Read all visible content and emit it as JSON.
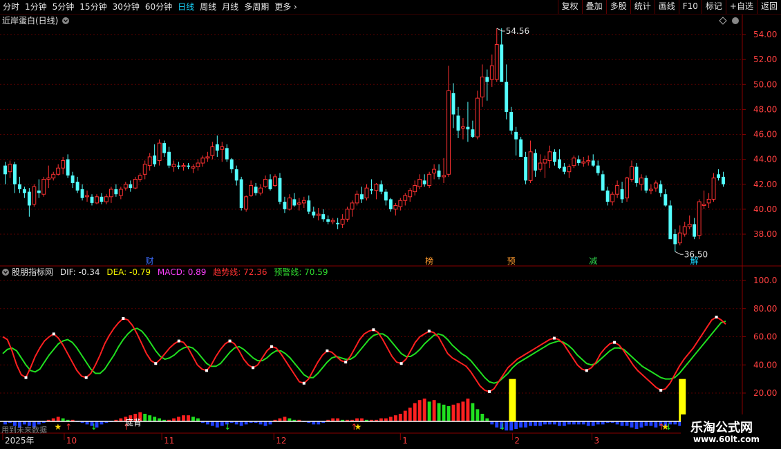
{
  "toolbar": {
    "periods": [
      "分时",
      "1分钟",
      "5分钟",
      "15分钟",
      "30分钟",
      "60分钟",
      "日线",
      "周线",
      "月线",
      "多周期",
      "更多"
    ],
    "active_period": "日线",
    "right_buttons": [
      "复权",
      "叠加",
      "多股",
      "统计",
      "画线",
      "F10",
      "标记",
      "+自选",
      "返回"
    ]
  },
  "main_panel": {
    "title": "近岸蛋白(日线)",
    "y_ticks": [
      "54.00",
      "52.00",
      "50.00",
      "48.00",
      "46.00",
      "44.00",
      "42.00",
      "40.00",
      "38.00"
    ],
    "high_marker": "54.56",
    "low_marker": "36.50",
    "event_tags": [
      {
        "text": "财",
        "color": "#3c6cff"
      },
      {
        "text": "榜",
        "color": "#ff9a2e"
      },
      {
        "text": "预",
        "color": "#ff9a2e"
      },
      {
        "text": "减",
        "color": "#2fd14b"
      },
      {
        "text": "解",
        "color": "#19d7ff"
      }
    ]
  },
  "indicator_panel": {
    "name": "股朋指标网",
    "dif": "DIF: -0.34",
    "dea": "DEA: -0.79",
    "macd": "MACD: 0.89",
    "trend": "趋势线: 72.36",
    "warn": "预警线: 70.59",
    "y_ticks": [
      "100.0",
      "80.00",
      "60.00",
      "40.00",
      "20.00"
    ],
    "annotation": "底背",
    "watermark": "用到未来数据"
  },
  "time_axis": {
    "labels": [
      "2025年",
      "10",
      "11",
      "12",
      "1",
      "2",
      "3"
    ]
  },
  "logo": {
    "line1": "乐淘公式网",
    "line2": "www.60lt.com"
  },
  "chart_data": {
    "type": "candlestick",
    "title": "近岸蛋白(日线)",
    "price_range": [
      36.0,
      55.5
    ],
    "up_color": "#ff3232",
    "down_color": "#54ffff",
    "candles": [
      [
        43.5,
        43.8,
        42.0,
        42.8
      ],
      [
        43.0,
        43.9,
        42.5,
        43.6
      ],
      [
        43.6,
        43.8,
        41.3,
        42.0
      ],
      [
        42.0,
        42.6,
        41.3,
        41.6
      ],
      [
        41.6,
        41.8,
        40.9,
        41.3
      ],
      [
        41.4,
        41.7,
        39.4,
        40.3
      ],
      [
        40.4,
        42.0,
        40.2,
        41.8
      ],
      [
        41.5,
        42.4,
        40.9,
        41.3
      ],
      [
        41.2,
        42.6,
        41.0,
        42.4
      ],
      [
        42.4,
        43.5,
        41.7,
        42.5
      ],
      [
        42.5,
        43.0,
        42.3,
        42.8
      ],
      [
        42.8,
        43.6,
        42.7,
        43.3
      ],
      [
        43.3,
        44.2,
        42.8,
        43.9
      ],
      [
        44.0,
        44.4,
        42.5,
        42.7
      ],
      [
        42.7,
        43.0,
        41.7,
        42.1
      ],
      [
        42.2,
        42.6,
        41.3,
        41.5
      ],
      [
        41.6,
        42.0,
        40.7,
        40.9
      ],
      [
        41.0,
        41.5,
        40.6,
        41.1
      ],
      [
        41.0,
        41.2,
        40.3,
        40.5
      ],
      [
        40.5,
        41.2,
        40.4,
        41.0
      ],
      [
        41.0,
        41.3,
        40.4,
        40.6
      ],
      [
        40.6,
        41.2,
        40.4,
        41.0
      ],
      [
        41.0,
        41.8,
        40.5,
        41.6
      ],
      [
        41.6,
        42.0,
        41.0,
        41.2
      ],
      [
        41.1,
        41.8,
        40.8,
        41.6
      ],
      [
        41.7,
        42.2,
        41.5,
        42.0
      ],
      [
        42.0,
        42.3,
        41.4,
        41.7
      ],
      [
        41.7,
        42.6,
        41.6,
        42.4
      ],
      [
        42.4,
        42.9,
        42.2,
        42.7
      ],
      [
        42.8,
        43.9,
        42.4,
        43.6
      ],
      [
        43.5,
        44.5,
        43.1,
        44.2
      ],
      [
        44.3,
        45.2,
        43.4,
        43.6
      ],
      [
        43.9,
        45.6,
        43.5,
        45.3
      ],
      [
        45.3,
        45.5,
        44.2,
        44.5
      ],
      [
        44.6,
        45.0,
        43.3,
        43.5
      ],
      [
        43.4,
        43.9,
        43.0,
        43.6
      ],
      [
        43.5,
        43.8,
        43.2,
        43.4
      ],
      [
        43.4,
        43.7,
        43.1,
        43.5
      ],
      [
        43.5,
        43.7,
        43.2,
        43.4
      ],
      [
        43.3,
        43.6,
        42.9,
        43.4
      ],
      [
        43.4,
        44.0,
        43.1,
        43.7
      ],
      [
        43.7,
        44.3,
        43.4,
        44.1
      ],
      [
        44.1,
        44.6,
        43.8,
        44.2
      ],
      [
        44.3,
        45.4,
        44.0,
        45.0
      ],
      [
        45.2,
        45.9,
        44.2,
        44.7
      ],
      [
        44.8,
        45.4,
        43.8,
        45.0
      ],
      [
        44.9,
        45.2,
        43.8,
        44.0
      ],
      [
        44.0,
        44.1,
        42.9,
        43.2
      ],
      [
        43.2,
        43.5,
        41.9,
        42.3
      ],
      [
        42.4,
        42.6,
        39.9,
        40.1
      ],
      [
        40.0,
        41.1,
        39.8,
        41.0
      ],
      [
        41.1,
        42.3,
        41.0,
        41.9
      ],
      [
        41.8,
        42.1,
        41.1,
        41.3
      ],
      [
        41.3,
        42.0,
        41.1,
        41.7
      ],
      [
        41.8,
        42.7,
        41.7,
        42.4
      ],
      [
        42.4,
        42.8,
        41.5,
        41.6
      ],
      [
        41.9,
        42.8,
        41.8,
        42.6
      ],
      [
        42.5,
        42.9,
        40.4,
        40.6
      ],
      [
        40.6,
        41.0,
        39.7,
        40.0
      ],
      [
        40.0,
        41.2,
        39.9,
        40.9
      ],
      [
        40.8,
        41.3,
        40.2,
        40.3
      ],
      [
        40.4,
        40.9,
        39.9,
        40.5
      ],
      [
        40.5,
        41.0,
        40.1,
        40.7
      ],
      [
        40.7,
        41.1,
        39.6,
        39.8
      ],
      [
        39.8,
        40.2,
        39.3,
        39.5
      ],
      [
        39.5,
        40.1,
        39.1,
        39.6
      ],
      [
        39.6,
        40.0,
        39.0,
        39.2
      ],
      [
        39.2,
        39.5,
        38.8,
        39.0
      ],
      [
        39.0,
        39.3,
        38.8,
        39.1
      ],
      [
        38.9,
        39.3,
        38.4,
        38.8
      ],
      [
        38.8,
        39.6,
        38.5,
        39.2
      ],
      [
        39.2,
        40.2,
        39.0,
        40.0
      ],
      [
        40.0,
        40.7,
        39.4,
        40.5
      ],
      [
        40.5,
        41.5,
        40.3,
        41.2
      ],
      [
        41.2,
        41.8,
        40.5,
        40.8
      ],
      [
        40.9,
        42.0,
        40.7,
        41.7
      ],
      [
        41.6,
        42.4,
        41.2,
        41.5
      ],
      [
        41.5,
        42.1,
        40.8,
        42.0
      ],
      [
        42.0,
        42.3,
        41.2,
        41.4
      ],
      [
        41.4,
        41.6,
        40.3,
        40.7
      ],
      [
        40.8,
        40.9,
        39.8,
        40.0
      ],
      [
        40.0,
        40.5,
        39.5,
        40.3
      ],
      [
        40.2,
        40.9,
        39.9,
        40.7
      ],
      [
        40.7,
        41.3,
        40.3,
        41.1
      ],
      [
        41.0,
        41.7,
        40.6,
        41.5
      ],
      [
        41.4,
        42.3,
        41.1,
        41.9
      ],
      [
        41.8,
        42.8,
        41.6,
        42.4
      ],
      [
        42.3,
        42.8,
        41.8,
        42.0
      ],
      [
        41.9,
        43.0,
        41.7,
        42.8
      ],
      [
        42.9,
        43.6,
        42.4,
        43.2
      ],
      [
        43.1,
        43.6,
        42.4,
        42.6
      ],
      [
        42.6,
        44.1,
        42.1,
        42.7
      ],
      [
        42.8,
        51.5,
        42.6,
        49.5
      ],
      [
        49.3,
        50.1,
        46.5,
        47.6
      ],
      [
        47.5,
        48.2,
        45.7,
        46.3
      ],
      [
        46.5,
        47.3,
        45.6,
        46.6
      ],
      [
        46.6,
        48.6,
        45.4,
        46.4
      ],
      [
        46.4,
        47.1,
        45.7,
        45.8
      ],
      [
        45.8,
        49.5,
        45.6,
        48.9
      ],
      [
        49.0,
        51.6,
        48.2,
        50.6
      ],
      [
        50.6,
        51.2,
        48.7,
        50.2
      ],
      [
        50.4,
        52.4,
        49.8,
        51.5
      ],
      [
        50.4,
        54.5,
        50.2,
        53.2
      ],
      [
        53.2,
        54.5,
        50.8,
        50.2
      ],
      [
        50.2,
        51.6,
        47.2,
        47.8
      ],
      [
        47.8,
        48.2,
        46.0,
        46.3
      ],
      [
        46.2,
        46.6,
        44.3,
        45.6
      ],
      [
        45.6,
        45.8,
        44.3,
        44.2
      ],
      [
        44.2,
        44.6,
        42.0,
        42.3
      ],
      [
        42.3,
        45.5,
        42.1,
        44.6
      ],
      [
        44.5,
        44.8,
        42.6,
        43.1
      ],
      [
        43.2,
        44.4,
        43.0,
        43.7
      ],
      [
        43.7,
        44.3,
        42.5,
        44.0
      ],
      [
        43.9,
        45.1,
        43.3,
        44.6
      ],
      [
        44.6,
        44.8,
        43.5,
        43.8
      ],
      [
        44.0,
        44.8,
        43.2,
        43.3
      ],
      [
        43.4,
        43.7,
        42.8,
        43.0
      ],
      [
        43.0,
        43.6,
        42.5,
        43.4
      ],
      [
        43.5,
        44.3,
        43.3,
        44.1
      ],
      [
        44.0,
        44.3,
        43.5,
        43.7
      ],
      [
        43.7,
        44.2,
        43.4,
        43.8
      ],
      [
        43.8,
        44.3,
        43.5,
        43.9
      ],
      [
        43.9,
        44.4,
        43.4,
        43.5
      ],
      [
        43.5,
        43.9,
        42.7,
        42.9
      ],
      [
        42.8,
        43.1,
        41.5,
        41.5
      ],
      [
        41.5,
        41.8,
        40.3,
        40.6
      ],
      [
        40.6,
        41.4,
        40.3,
        41.2
      ],
      [
        41.2,
        42.3,
        40.9,
        41.9
      ],
      [
        41.6,
        42.2,
        40.5,
        40.8
      ],
      [
        40.9,
        42.6,
        40.6,
        42.5
      ],
      [
        42.4,
        43.9,
        42.2,
        43.4
      ],
      [
        43.4,
        43.7,
        41.8,
        42.1
      ],
      [
        42.0,
        42.8,
        41.5,
        42.5
      ],
      [
        42.5,
        42.7,
        41.3,
        41.5
      ],
      [
        41.5,
        42.0,
        41.2,
        41.6
      ],
      [
        41.7,
        42.3,
        41.4,
        42.1
      ],
      [
        42.0,
        42.3,
        41.0,
        41.3
      ],
      [
        41.2,
        41.6,
        40.2,
        40.3
      ],
      [
        40.3,
        40.7,
        38.0,
        37.6
      ],
      [
        38.0,
        38.4,
        36.6,
        37.2
      ],
      [
        37.3,
        38.7,
        37.1,
        38.1
      ],
      [
        38.0,
        39.0,
        37.8,
        38.6
      ],
      [
        38.6,
        39.5,
        38.4,
        38.8
      ],
      [
        38.8,
        39.3,
        37.6,
        37.8
      ],
      [
        37.9,
        40.8,
        37.6,
        40.6
      ],
      [
        40.3,
        41.5,
        40.0,
        40.4
      ],
      [
        40.5,
        41.3,
        40.1,
        40.8
      ],
      [
        40.8,
        42.9,
        40.6,
        42.5
      ],
      [
        42.8,
        43.2,
        42.3,
        42.5
      ],
      [
        42.6,
        43.0,
        41.8,
        42.0
      ]
    ],
    "indicator": {
      "y_range": [
        0,
        110
      ],
      "line_red": [
        60,
        58,
        50,
        40,
        33,
        31,
        38,
        46,
        52,
        57,
        60,
        62,
        59,
        54,
        48,
        42,
        36,
        32,
        31,
        34,
        40,
        47,
        55,
        61,
        66,
        70,
        73,
        72,
        68,
        62,
        55,
        48,
        43,
        41,
        44,
        48,
        52,
        55,
        57,
        56,
        52,
        46,
        40,
        37,
        36,
        40,
        46,
        51,
        55,
        57,
        55,
        50,
        44,
        40,
        38,
        40,
        45,
        50,
        53,
        52,
        48,
        43,
        38,
        33,
        28,
        27,
        30,
        36,
        42,
        47,
        50,
        49,
        46,
        43,
        42,
        46,
        52,
        58,
        62,
        64,
        65,
        63,
        58,
        52,
        46,
        42,
        41,
        44,
        50,
        56,
        60,
        62,
        64,
        63,
        60,
        54,
        48,
        45,
        43,
        41,
        39,
        35,
        30,
        25,
        22,
        21,
        23,
        28,
        33,
        38,
        41,
        44,
        46,
        48,
        50,
        52,
        54,
        56,
        58,
        59,
        58,
        55,
        50,
        45,
        40,
        37,
        36,
        38,
        42,
        48,
        52,
        55,
        56,
        54,
        50,
        45,
        40,
        36,
        33,
        30,
        27,
        24,
        22,
        23,
        27,
        33,
        39,
        44,
        48,
        52,
        57,
        62,
        67,
        72,
        74,
        72,
        69
      ],
      "line_green": [
        48,
        51,
        52,
        50,
        45,
        40,
        36,
        35,
        37,
        42,
        47,
        51,
        55,
        57,
        58,
        56,
        52,
        47,
        42,
        37,
        34,
        34,
        37,
        42,
        47,
        53,
        58,
        62,
        65,
        66,
        64,
        60,
        55,
        50,
        46,
        44,
        45,
        47,
        50,
        52,
        53,
        52,
        49,
        45,
        41,
        39,
        39,
        41,
        45,
        49,
        52,
        53,
        51,
        48,
        45,
        43,
        43,
        45,
        48,
        50,
        50,
        48,
        45,
        41,
        37,
        33,
        31,
        31,
        34,
        38,
        42,
        45,
        46,
        45,
        44,
        44,
        46,
        50,
        54,
        58,
        61,
        62,
        62,
        60,
        56,
        52,
        48,
        46,
        46,
        48,
        51,
        55,
        58,
        61,
        62,
        61,
        58,
        54,
        51,
        48,
        46,
        43,
        39,
        35,
        31,
        28,
        27,
        28,
        31,
        34,
        38,
        41,
        43,
        45,
        47,
        49,
        51,
        53,
        55,
        56,
        57,
        56,
        54,
        51,
        47,
        44,
        41,
        40,
        41,
        44,
        47,
        50,
        52,
        52,
        51,
        48,
        45,
        42,
        39,
        37,
        35,
        33,
        31,
        30,
        30,
        31,
        34,
        38,
        42,
        46,
        50,
        54,
        58,
        62,
        66,
        70,
        71
      ],
      "hist": [
        -2,
        -1,
        -3,
        -4,
        -2,
        -3,
        -4,
        -2,
        -1,
        1,
        2,
        3,
        2,
        1,
        1,
        0,
        -1,
        -2,
        -3,
        -4,
        -2,
        -1,
        0,
        1,
        2,
        3,
        4,
        5,
        6,
        5,
        4,
        3,
        2,
        1,
        1,
        2,
        3,
        4,
        4,
        3,
        2,
        -1,
        -2,
        -3,
        -4,
        -3,
        -2,
        -1,
        -2,
        -3,
        -2,
        -1,
        -1,
        -2,
        -3,
        -2,
        1,
        2,
        3,
        2,
        1,
        1,
        0,
        -1,
        -2,
        -2,
        -1,
        1,
        2,
        2,
        1,
        1,
        1,
        2,
        2,
        1,
        1,
        1,
        2,
        2,
        3,
        4,
        5,
        7,
        9,
        12,
        14,
        15,
        13,
        14,
        12,
        11,
        10,
        11,
        12,
        13,
        15,
        12,
        8,
        5,
        2,
        -2,
        -4,
        -5,
        -6,
        -6,
        -5,
        -4,
        -4,
        -3,
        -3,
        -3,
        -2,
        -2,
        -2,
        -3,
        -3,
        -2,
        -2,
        -2,
        -2,
        -3,
        -3,
        -2,
        -2,
        -1,
        -1,
        -2,
        -3,
        -3,
        -4,
        -5,
        -4,
        -3,
        -3,
        -4,
        -3,
        -3,
        -2,
        -2,
        -3,
        -2,
        -2,
        -3,
        -3,
        -4,
        -4,
        -3,
        -2,
        -2,
        -3,
        -3,
        -4,
        -4,
        -4,
        -3
      ]
    }
  }
}
